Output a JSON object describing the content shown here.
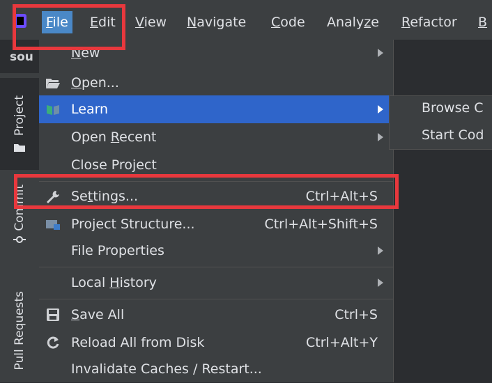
{
  "menubar": {
    "items": [
      {
        "label": "File",
        "mnemonic": "F",
        "rest": "ile",
        "active": true
      },
      {
        "label": "Edit",
        "mnemonic": "E",
        "rest": "dit"
      },
      {
        "label": "View",
        "mnemonic": "V",
        "rest": "iew"
      },
      {
        "label": "Navigate",
        "mnemonic": "N",
        "rest": "avigate"
      },
      {
        "label": "Code",
        "mnemonic": "C",
        "rest": "ode"
      },
      {
        "label": "Analyze",
        "pre": "Analy",
        "mnemonic": "z",
        "rest": "e"
      },
      {
        "label": "Refactor",
        "mnemonic": "R",
        "rest": "efactor"
      },
      {
        "label": "B",
        "mnemonic": "B",
        "rest": ""
      }
    ]
  },
  "sidebar": {
    "top_label": "sou",
    "tabs": [
      {
        "label": "Project",
        "selected": true
      },
      {
        "label": "Commit"
      },
      {
        "label": "Pull Requests"
      }
    ]
  },
  "file_menu": {
    "items": [
      {
        "pre": "",
        "mnemonic": "N",
        "post": "ew",
        "shortcut": "",
        "submenu": true,
        "icon": ""
      },
      {
        "pre": "",
        "mnemonic": "O",
        "post": "pen...",
        "shortcut": "",
        "submenu": false,
        "icon": "folder-icon"
      },
      {
        "pre": "Learn",
        "mnemonic": "",
        "post": "",
        "shortcut": "",
        "submenu": true,
        "icon": "learn-book-icon",
        "highlight": true
      },
      {
        "pre": "Open ",
        "mnemonic": "R",
        "post": "ecent",
        "shortcut": "",
        "submenu": true,
        "icon": ""
      },
      {
        "pre": "Close Project",
        "mnemonic": "",
        "post": "",
        "shortcut": "",
        "submenu": false,
        "icon": ""
      },
      {
        "pre": "Se",
        "mnemonic": "t",
        "post": "tings...",
        "shortcut": "Ctrl+Alt+S",
        "submenu": false,
        "icon": "wrench-icon"
      },
      {
        "pre": "Project Structure...",
        "mnemonic": "",
        "post": "",
        "shortcut": "Ctrl+Alt+Shift+S",
        "submenu": false,
        "icon": "project-structure-icon"
      },
      {
        "pre": "File Properties",
        "mnemonic": "",
        "post": "",
        "shortcut": "",
        "submenu": true,
        "icon": ""
      },
      {
        "pre": "Local ",
        "mnemonic": "H",
        "post": "istory",
        "shortcut": "",
        "submenu": true,
        "icon": ""
      },
      {
        "pre": "",
        "mnemonic": "S",
        "post": "ave All",
        "shortcut": "Ctrl+S",
        "submenu": false,
        "icon": "save-icon"
      },
      {
        "pre": "Reload All from Disk",
        "mnemonic": "",
        "post": "",
        "shortcut": "Ctrl+Alt+Y",
        "submenu": false,
        "icon": "reload-icon"
      },
      {
        "pre": "Invalidate Caches / Restart...",
        "mnemonic": "",
        "post": "",
        "shortcut": "",
        "submenu": false,
        "icon": ""
      }
    ]
  },
  "learn_submenu": {
    "items": [
      "Browse C",
      "Start Cod"
    ]
  },
  "colors": {
    "highlight": "#2f65ca",
    "menubar_active": "#4a88c7",
    "annotation_red": "#e8383d"
  }
}
